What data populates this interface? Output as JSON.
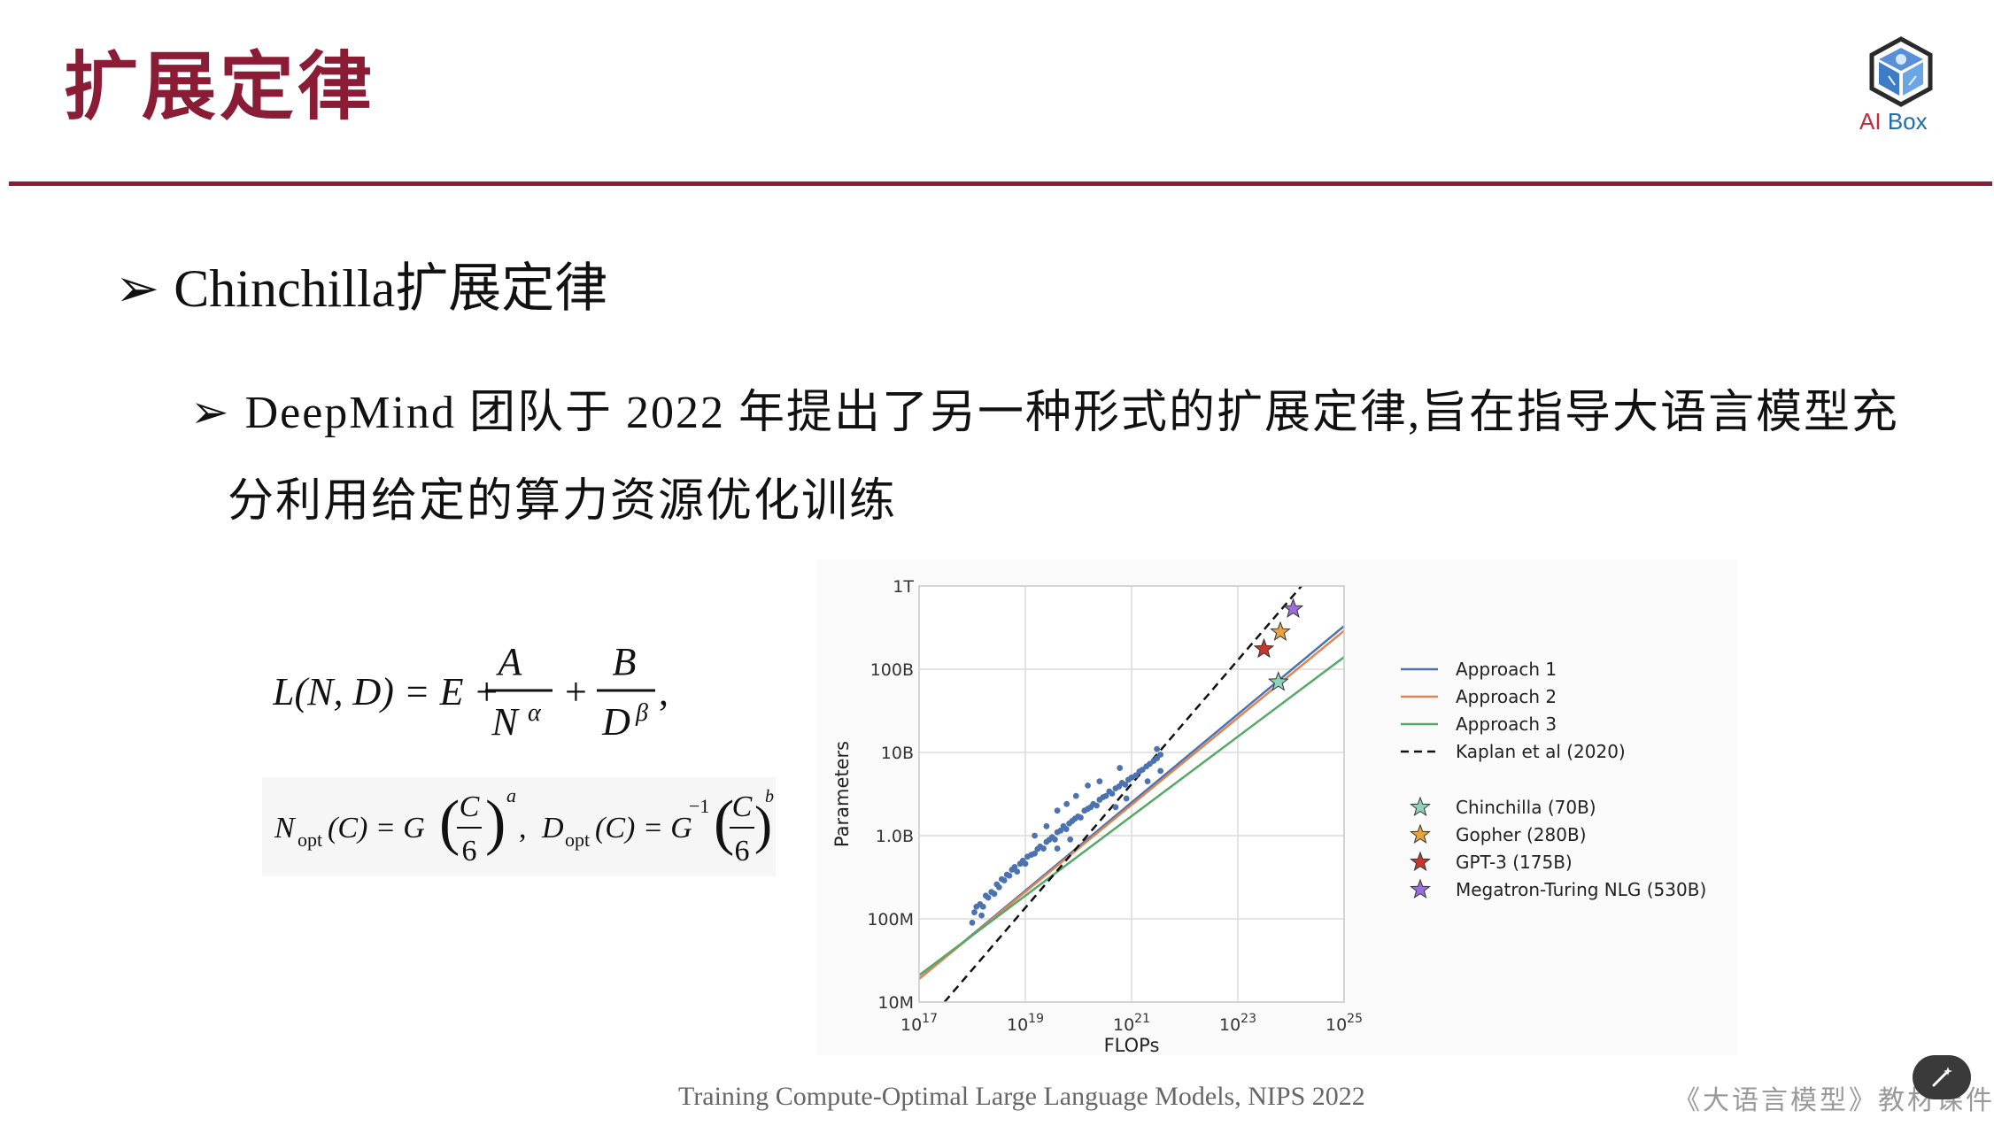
{
  "header": {
    "title": "扩展定律",
    "logo": {
      "ai": "AI",
      "box": "Box"
    }
  },
  "content": {
    "bullet1": "Chinchilla扩展定律",
    "bullet2_line1": "DeepMind 团队于 2022 年提出了另一种形式的扩展定律,旨在指导大语言模型充",
    "bullet2_line2": "分利用给定的算力资源优化训练",
    "arrow_glyph": "➢"
  },
  "formulas": {
    "loss": {
      "lhs": "L(N, D) = E +",
      "a_num": "A",
      "a_den": "N",
      "a_exp": "α",
      "plus": "+",
      "b_num": "B",
      "b_den": "D",
      "b_exp": "β",
      "tail": ","
    },
    "optimal": {
      "n_lhs": "N",
      "n_sub": "opt",
      "n_mid": "(C) = G",
      "frac_num": "C",
      "frac_den": "6",
      "exp_a": "a",
      "comma": ",",
      "d_lhs": "D",
      "d_sub": "opt",
      "d_mid": "(C) = G",
      "g_exp": "−1",
      "exp_b": "b",
      "end": ","
    }
  },
  "chart_data": {
    "type": "line",
    "xlabel": "FLOPs",
    "ylabel": "Parameters",
    "x_scale": "log",
    "y_scale": "log",
    "xlim": [
      1e+17,
      1e+25
    ],
    "ylim": [
      10000000.0,
      1000000000000.0
    ],
    "x_tick_bases": [
      "10",
      "10",
      "10",
      "10",
      "10"
    ],
    "x_tick_exps": [
      "17",
      "19",
      "21",
      "23",
      "25"
    ],
    "x_tick_values": [
      1e+17,
      1e+19,
      1e+21,
      1e+23,
      1e+25
    ],
    "y_ticks": [
      "10M",
      "100M",
      "1.0B",
      "10B",
      "100B",
      "1T"
    ],
    "y_tick_values": [
      10000000.0,
      100000000.0,
      1000000000.0,
      10000000000.0,
      100000000000.0,
      1000000000000.0
    ],
    "grid": true,
    "legend_position": "right",
    "series": [
      {
        "name": "Approach 1",
        "color": "#4c72b0",
        "style": "solid",
        "x": [
          1e+17,
          1e+25
        ],
        "y": [
          19000000.0,
          330000000000.0
        ]
      },
      {
        "name": "Approach 2",
        "color": "#dd8452",
        "style": "solid",
        "x": [
          1e+17,
          1e+25
        ],
        "y": [
          19000000.0,
          290000000000.0
        ]
      },
      {
        "name": "Approach 3",
        "color": "#55a868",
        "style": "solid",
        "x": [
          1e+17,
          1e+25
        ],
        "y": [
          21000000.0,
          140000000000.0
        ]
      },
      {
        "name": "Kaplan et al (2020)",
        "color": "#111111",
        "style": "dashed",
        "x": [
          3e+17,
          4e+24
        ],
        "y": [
          10000000.0,
          2000000000000.0
        ]
      }
    ],
    "models": [
      {
        "name": "Chinchilla (70B)",
        "flops": 5.8e+23,
        "params": 70000000000.0,
        "color": "#8fd1bb"
      },
      {
        "name": "Gopher (280B)",
        "flops": 6.3e+23,
        "params": 280000000000.0,
        "color": "#e8a33d"
      },
      {
        "name": "GPT-3 (175B)",
        "flops": 3.1e+23,
        "params": 175000000000.0,
        "color": "#c9362e"
      },
      {
        "name": "Megatron-Turing NLG (530B)",
        "flops": 1.1e+24,
        "params": 530000000000.0,
        "color": "#9a6fdb"
      }
    ],
    "scatter_color": "#4c72b0",
    "scatter": [
      [
        1.1e+18,
        120000000.0
      ],
      [
        1.2e+18,
        140000000.0
      ],
      [
        1.4e+18,
        150000000.0
      ],
      [
        1.6e+18,
        140000000.0
      ],
      [
        1.8e+18,
        190000000.0
      ],
      [
        2e+18,
        180000000.0
      ],
      [
        2.3e+18,
        210000000.0
      ],
      [
        2.6e+18,
        200000000.0
      ],
      [
        2.9e+18,
        260000000.0
      ],
      [
        3.2e+18,
        240000000.0
      ],
      [
        3.6e+18,
        300000000.0
      ],
      [
        4e+18,
        290000000.0
      ],
      [
        4.5e+18,
        340000000.0
      ],
      [
        5e+18,
        330000000.0
      ],
      [
        5.6e+18,
        390000000.0
      ],
      [
        6.3e+18,
        420000000.0
      ],
      [
        7e+18,
        370000000.0
      ],
      [
        8e+18,
        460000000.0
      ],
      [
        9e+18,
        500000000.0
      ],
      [
        1e+19,
        460000000.0
      ],
      [
        1.1e+19,
        560000000.0
      ],
      [
        1.3e+19,
        590000000.0
      ],
      [
        1.5e+19,
        610000000.0
      ],
      [
        1.7e+19,
        690000000.0
      ],
      [
        1.9e+19,
        740000000.0
      ],
      [
        2.2e+19,
        700000000.0
      ],
      [
        2.5e+19,
        840000000.0
      ],
      [
        2.8e+19,
        890000000.0
      ],
      [
        3.2e+19,
        960000000.0
      ],
      [
        3.6e+19,
        900000000.0
      ],
      [
        4e+19,
        1100000000.0
      ],
      [
        4.6e+19,
        1150000000.0
      ],
      [
        5.2e+19,
        1300000000.0
      ],
      [
        5.9e+19,
        1200000000.0
      ],
      [
        6.7e+19,
        1400000000.0
      ],
      [
        7.6e+19,
        1500000000.0
      ],
      [
        8.6e+19,
        1600000000.0
      ],
      [
        9.8e+19,
        1700000000.0
      ],
      [
        1.1e+20,
        1650000000.0
      ],
      [
        1.3e+20,
        2000000000.0
      ],
      [
        1.5e+20,
        2100000000.0
      ],
      [
        1.7e+20,
        2200000000.0
      ],
      [
        1.9e+20,
        2400000000.0
      ],
      [
        2.2e+20,
        2300000000.0
      ],
      [
        2.5e+20,
        2700000000.0
      ],
      [
        2.9e+20,
        2900000000.0
      ],
      [
        3.3e+20,
        3000000000.0
      ],
      [
        3.8e+20,
        3400000000.0
      ],
      [
        4.3e+20,
        3200000000.0
      ],
      [
        5e+20,
        3700000000.0
      ],
      [
        5.8e+20,
        3900000000.0
      ],
      [
        6.6e+20,
        4300000000.0
      ],
      [
        7.6e+20,
        4100000000.0
      ],
      [
        8.7e+20,
        4700000000.0
      ],
      [
        1e+21,
        5000000000.0
      ],
      [
        1.2e+21,
        5300000000.0
      ],
      [
        1.4e+21,
        5900000000.0
      ],
      [
        1.6e+21,
        6200000000.0
      ],
      [
        1.9e+21,
        6800000000.0
      ],
      [
        2.2e+21,
        7300000000.0
      ],
      [
        2.6e+21,
        7900000000.0
      ],
      [
        3e+21,
        8500000000.0
      ],
      [
        3.5e+21,
        9400000000.0
      ],
      [
        1.5e+19,
        1000000000.0
      ],
      [
        2.5e+19,
        1300000000.0
      ],
      [
        4e+19,
        2000000000.0
      ],
      [
        6e+19,
        2400000000.0
      ],
      [
        9e+19,
        3000000000.0
      ],
      [
        1.5e+20,
        4000000000.0
      ],
      [
        2.5e+20,
        4500000000.0
      ],
      [
        4e+19,
        700000000.0
      ],
      [
        7e+19,
        900000000.0
      ],
      [
        1e+18,
        90000000.0
      ],
      [
        1.5e+18,
        110000000.0
      ],
      [
        5e+20,
        2200000000.0
      ],
      [
        8e+20,
        2800000000.0
      ],
      [
        2e+21,
        4500000000.0
      ],
      [
        3.5e+21,
        6000000000.0
      ],
      [
        6e+20,
        6500000000.0
      ],
      [
        3e+21,
        11000000000.0
      ]
    ]
  },
  "caption": "Training Compute-Optimal Large Language Models, NIPS 2022",
  "footer": "《大语言模型》教材课件"
}
